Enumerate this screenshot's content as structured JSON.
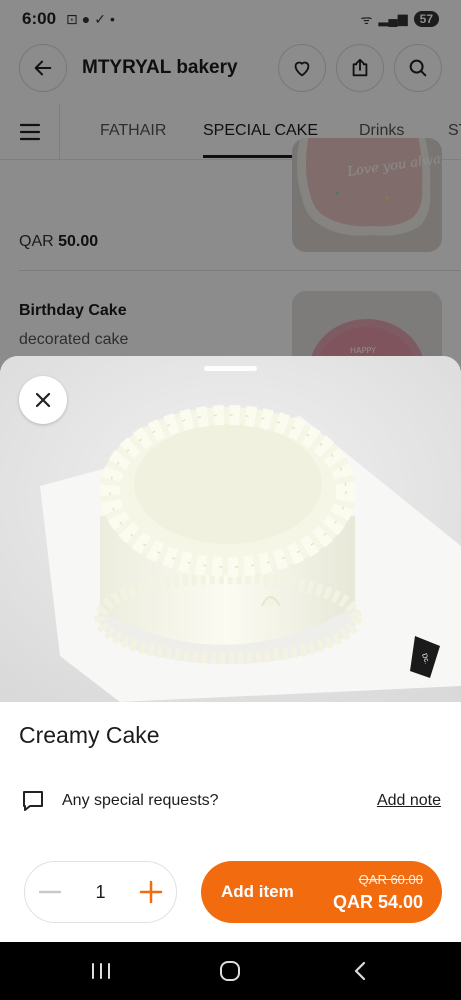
{
  "status_bar": {
    "time": "6:00",
    "battery": "57"
  },
  "store": {
    "title": "MTYRYAL bakery"
  },
  "tabs": [
    {
      "label": "FATHAIR"
    },
    {
      "label": "SPECIAL CAKE"
    },
    {
      "label": "Drinks"
    },
    {
      "label": "ST"
    }
  ],
  "menu_items": [
    {
      "price_prefix": "QAR",
      "price": "50.00",
      "image_text": "Love you always"
    },
    {
      "title": "Birthday Cake",
      "description": "decorated cake",
      "image_text": "HAPPY"
    }
  ],
  "product": {
    "name": "Creamy Cake",
    "special_requests_label": "Any special requests?",
    "add_note_label": "Add note",
    "quantity": "1",
    "add_label": "Add item",
    "old_price": "QAR 60.00",
    "new_price": "QAR 54.00",
    "box_label": "Dc."
  },
  "colors": {
    "accent": "#f26b0f"
  }
}
